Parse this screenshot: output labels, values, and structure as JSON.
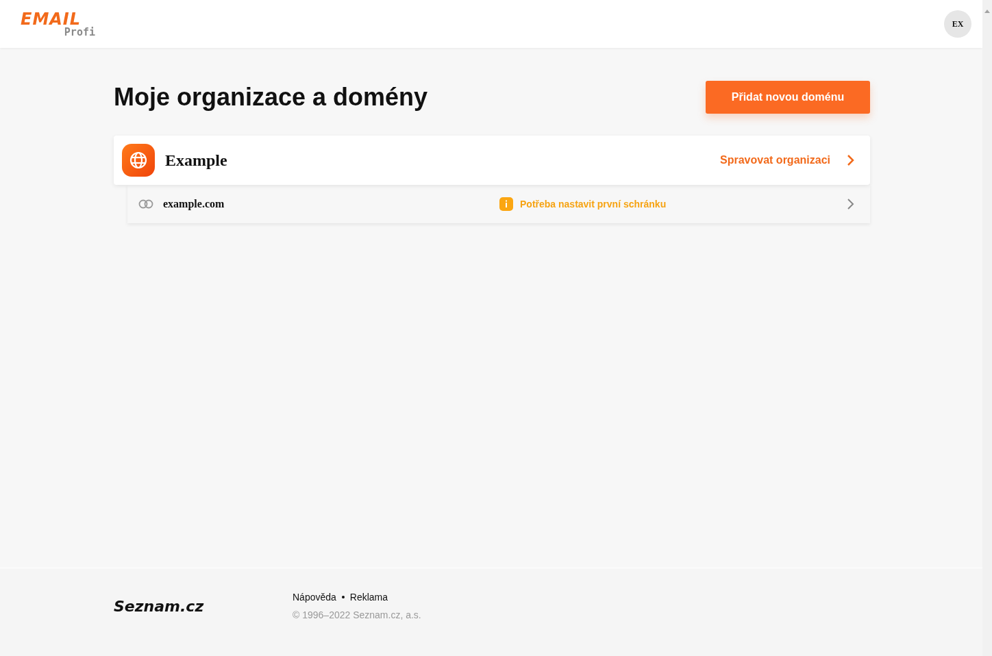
{
  "header": {
    "logo": {
      "word": "EMAIL",
      "sub": "Profi"
    },
    "avatar": "EX"
  },
  "page": {
    "title": "Moje organizace a domény",
    "add_button": "Přidat novou doménu"
  },
  "organizations": [
    {
      "name": "Example",
      "manage_link": "Spravovat organizaci",
      "domains": [
        {
          "name": "example.com",
          "status": "Potřeba nastavit první schránku",
          "kind": "warning"
        }
      ]
    }
  ],
  "footer": {
    "logo": "Seznam.cz",
    "links": [
      "Nápověda",
      "Reklama"
    ],
    "copyright": "© 1996–2022 Seznam.cz, a.s."
  }
}
